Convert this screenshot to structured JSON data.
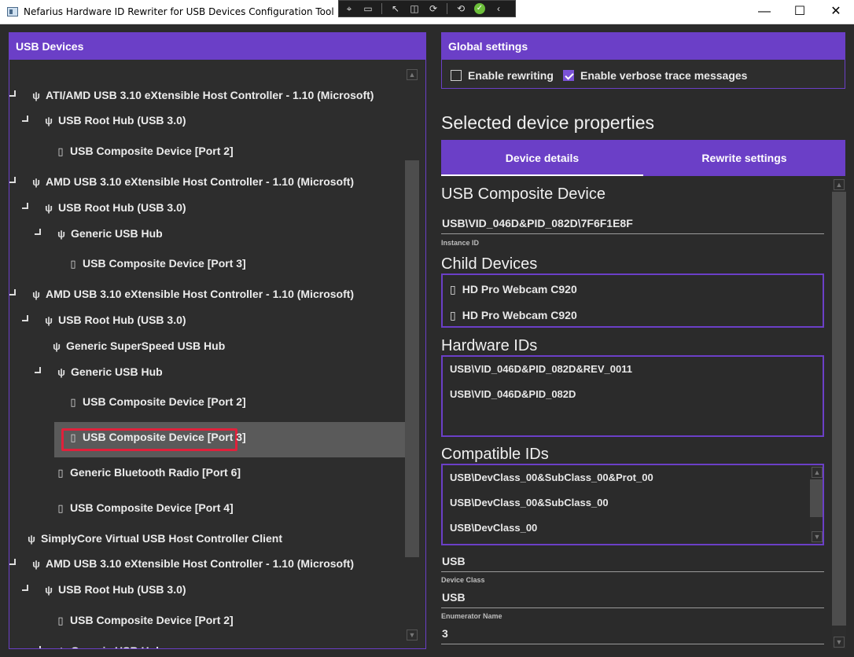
{
  "window": {
    "title": "Nefarius Hardware ID Rewriter for USB Devices Configuration Tool",
    "minimize": "—",
    "maximize": "☐",
    "close": "✕"
  },
  "left_panel": {
    "header": "USB Devices",
    "tree": [
      {
        "label": "ATI/AMD USB 3.10 eXtensible Host Controller - 1.10 (Microsoft)",
        "icon": "usb-icon",
        "expanded": true
      },
      {
        "label": "USB Root Hub (USB 3.0)",
        "icon": "usb-icon",
        "expanded": true
      },
      {
        "label": "USB Composite Device [Port 2]",
        "icon": "usb-plug-icon"
      },
      {
        "label": "AMD USB 3.10 eXtensible Host Controller - 1.10 (Microsoft)",
        "icon": "usb-icon",
        "expanded": true
      },
      {
        "label": "USB Root Hub (USB 3.0)",
        "icon": "usb-icon",
        "expanded": true
      },
      {
        "label": "Generic USB Hub",
        "icon": "usb-icon",
        "expanded": true
      },
      {
        "label": "USB Composite Device [Port 3]",
        "icon": "usb-plug-icon"
      },
      {
        "label": "AMD USB 3.10 eXtensible Host Controller - 1.10 (Microsoft)",
        "icon": "usb-icon",
        "expanded": true
      },
      {
        "label": "USB Root Hub (USB 3.0)",
        "icon": "usb-icon",
        "expanded": true
      },
      {
        "label": "Generic SuperSpeed USB Hub",
        "icon": "usb-icon"
      },
      {
        "label": "Generic USB Hub",
        "icon": "usb-icon",
        "expanded": true
      },
      {
        "label": "USB Composite Device [Port 2]",
        "icon": "usb-plug-icon"
      },
      {
        "label": "USB Composite Device [Port 3]",
        "icon": "usb-plug-icon",
        "selected": true
      },
      {
        "label": "Generic Bluetooth Radio [Port 6]",
        "icon": "usb-plug-icon"
      },
      {
        "label": "USB Composite Device [Port 4]",
        "icon": "usb-plug-icon"
      },
      {
        "label": "SimplyCore Virtual USB Host Controller Client",
        "icon": "usb-icon"
      },
      {
        "label": "AMD USB 3.10 eXtensible Host Controller - 1.10 (Microsoft)",
        "icon": "usb-icon",
        "expanded": true
      },
      {
        "label": "USB Root Hub (USB 3.0)",
        "icon": "usb-icon",
        "expanded": true
      },
      {
        "label": "USB Composite Device [Port 2]",
        "icon": "usb-plug-icon"
      },
      {
        "label": "Generic USB Hub",
        "icon": "usb-icon",
        "expanded": true
      }
    ]
  },
  "global_settings": {
    "header": "Global settings",
    "enable_rewriting": {
      "label": "Enable rewriting",
      "checked": false
    },
    "enable_verbose": {
      "label": "Enable verbose trace messages",
      "checked": true
    }
  },
  "selected": {
    "title": "Selected device properties",
    "tabs": [
      {
        "label": "Device details",
        "active": true
      },
      {
        "label": "Rewrite settings",
        "active": false
      }
    ],
    "device_name": "USB Composite Device",
    "instance_id": {
      "value": "USB\\VID_046D&PID_082D\\7F6F1E8F",
      "label": "Instance ID"
    },
    "child_devices": {
      "title": "Child Devices",
      "items": [
        "HD Pro Webcam C920",
        "HD Pro Webcam C920"
      ]
    },
    "hardware_ids": {
      "title": "Hardware IDs",
      "items": [
        "USB\\VID_046D&PID_082D&REV_0011",
        "USB\\VID_046D&PID_082D"
      ]
    },
    "compatible_ids": {
      "title": "Compatible IDs",
      "items": [
        "USB\\DevClass_00&SubClass_00&Prot_00",
        "USB\\DevClass_00&SubClass_00",
        "USB\\DevClass_00"
      ]
    },
    "device_class": {
      "value": "USB",
      "label": "Device Class"
    },
    "enumerator_name": {
      "value": "USB",
      "label": "Enumerator Name"
    },
    "extra_value": "3"
  },
  "colors": {
    "accent": "#6b3fc7",
    "selection_highlight": "#e0213b",
    "background": "#2b2b2b"
  }
}
